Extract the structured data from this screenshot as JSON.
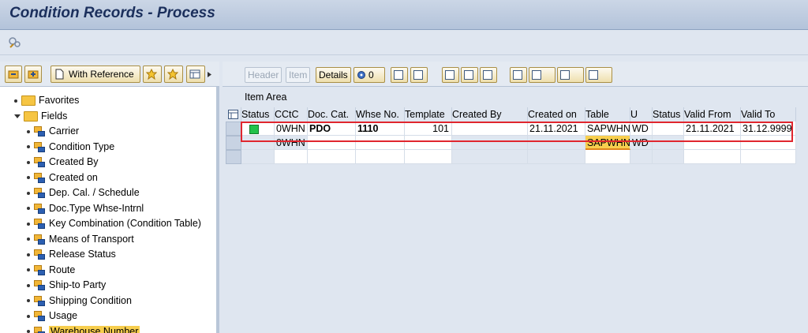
{
  "window": {
    "title": "Condition Records - Process"
  },
  "left_toolbar": {
    "with_reference_label": "With Reference"
  },
  "tree": [
    {
      "label": "Favorites",
      "kind": "folder",
      "indent": 0,
      "expanded": false
    },
    {
      "label": "Fields",
      "kind": "folder",
      "indent": 0,
      "expanded": true
    },
    {
      "label": "Carrier",
      "kind": "field",
      "indent": 1
    },
    {
      "label": "Condition Type",
      "kind": "field",
      "indent": 1
    },
    {
      "label": "Created By",
      "kind": "field",
      "indent": 1
    },
    {
      "label": "Created on",
      "kind": "field",
      "indent": 1
    },
    {
      "label": "Dep. Cal. / Schedule",
      "kind": "field",
      "indent": 1
    },
    {
      "label": "Doc.Type Whse-Intrnl",
      "kind": "field",
      "indent": 1
    },
    {
      "label": "Key Combination (Condition Table)",
      "kind": "field",
      "indent": 1
    },
    {
      "label": "Means of Transport",
      "kind": "field",
      "indent": 1
    },
    {
      "label": "Release Status",
      "kind": "field",
      "indent": 1
    },
    {
      "label": "Route",
      "kind": "field",
      "indent": 1
    },
    {
      "label": "Ship-to Party",
      "kind": "field",
      "indent": 1
    },
    {
      "label": "Shipping Condition",
      "kind": "field",
      "indent": 1
    },
    {
      "label": "Usage",
      "kind": "field",
      "indent": 1
    },
    {
      "label": "Warehouse Number",
      "kind": "field",
      "indent": 1,
      "selected": true
    }
  ],
  "right_toolbar": {
    "header_label": "Header",
    "item_label": "Item",
    "details_label": "Details",
    "count_label": "0"
  },
  "item_area_label": "Item Area",
  "grid": {
    "headers": [
      "Status",
      "CCtC",
      "Doc. Cat.",
      "Whse No.",
      "Template",
      "Created By",
      "Created on",
      "Table",
      "U",
      "Status",
      "Valid From",
      "Valid To"
    ],
    "rows": [
      {
        "status": "green",
        "cctc": "0WHN",
        "doc_cat": "PDO",
        "whse_no": "1110",
        "template": "101",
        "created_by": "",
        "created_on": "21.11.2021",
        "table": "SAPWHN",
        "u": "WD",
        "status2": "",
        "valid_from": "21.11.2021",
        "valid_to": "31.12.9999"
      },
      {
        "status": "",
        "cctc": "0WHN",
        "doc_cat": "",
        "whse_no": "",
        "template": "",
        "created_by": "",
        "created_on": "",
        "table": "SAPWHN",
        "u": "WD",
        "status2": "",
        "valid_from": "",
        "valid_to": ""
      }
    ]
  },
  "colors": {
    "status_green": "#22c24a",
    "highlight": "#e0262e",
    "selection": "#f7ce4e"
  }
}
